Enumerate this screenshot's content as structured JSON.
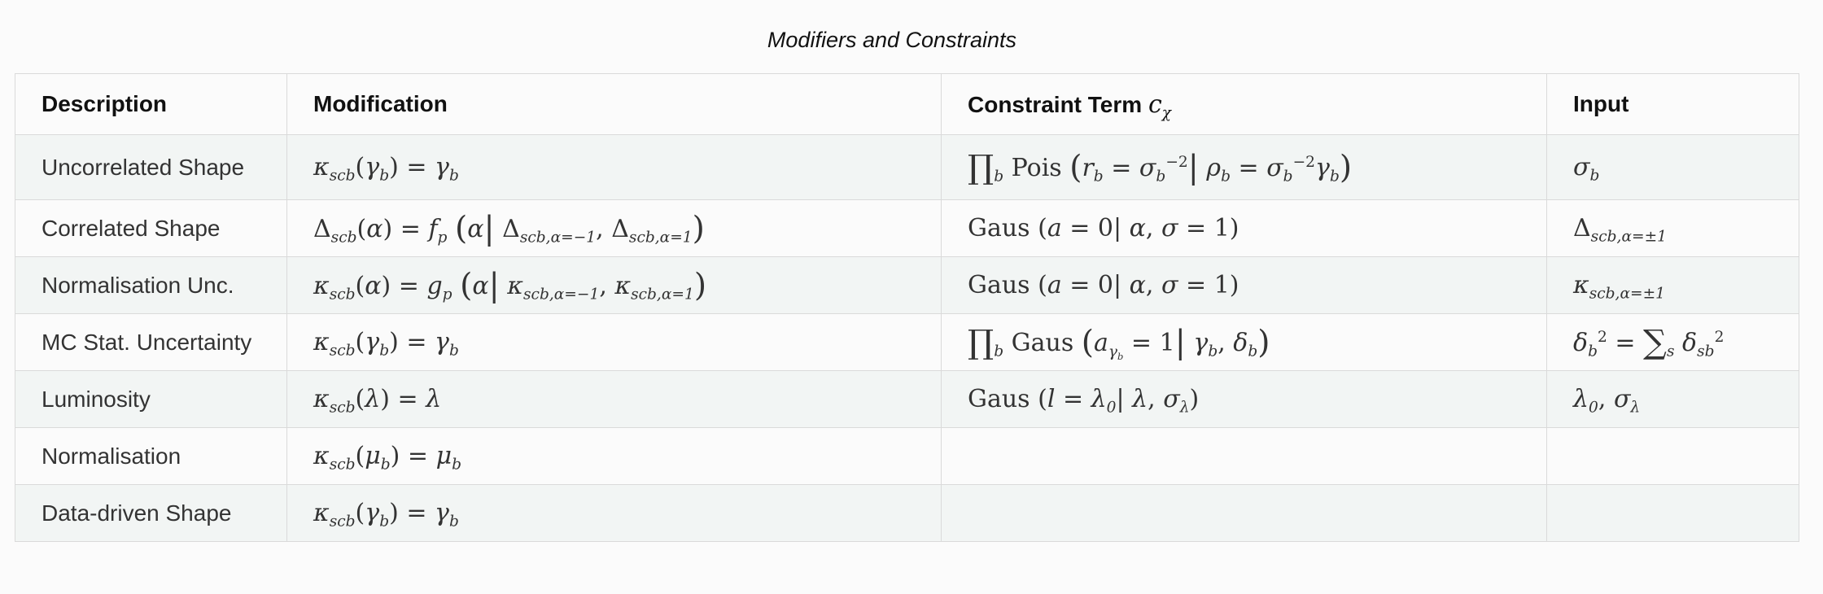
{
  "title": "Modifiers and Constraints",
  "headers": {
    "description": "Description",
    "modification": "Modification",
    "constraint": "Constraint Term",
    "constraint_symbol": "c",
    "constraint_symbol_sub": "χ",
    "input": "Input"
  },
  "rows": [
    {
      "description": "Uncorrelated Shape",
      "modification": "κscb(γb) = γb",
      "constraint": "∏b Pois (rb = σb−2 | ρb = σb−2 γb)",
      "input": "σb"
    },
    {
      "description": "Correlated Shape",
      "modification": "Δscb(α) = fp (α | Δscb,α=−1, Δscb,α=1)",
      "constraint": "Gaus (a = 0 | α, σ = 1)",
      "input": "Δscb,α=±1"
    },
    {
      "description": "Normalisation Unc.",
      "modification": "κscb(α) = gp (α | κscb,α=−1, κscb,α=1)",
      "constraint": "Gaus (a = 0 | α, σ = 1)",
      "input": "κscb,α=±1"
    },
    {
      "description": "MC Stat. Uncertainty",
      "modification": "κscb(γb) = γb",
      "constraint": "∏b Gaus (aγb = 1 | γb, δb)",
      "input": "δb2 = ∑s δsb2"
    },
    {
      "description": "Luminosity",
      "modification": "κscb(λ) = λ",
      "constraint": "Gaus (l = λ0 | λ, σλ)",
      "input": "λ0, σλ"
    },
    {
      "description": "Normalisation",
      "modification": "κscb(μb) = μb",
      "constraint": "",
      "input": ""
    },
    {
      "description": "Data-driven Shape",
      "modification": "κscb(γb) = γb",
      "constraint": "",
      "input": ""
    }
  ]
}
